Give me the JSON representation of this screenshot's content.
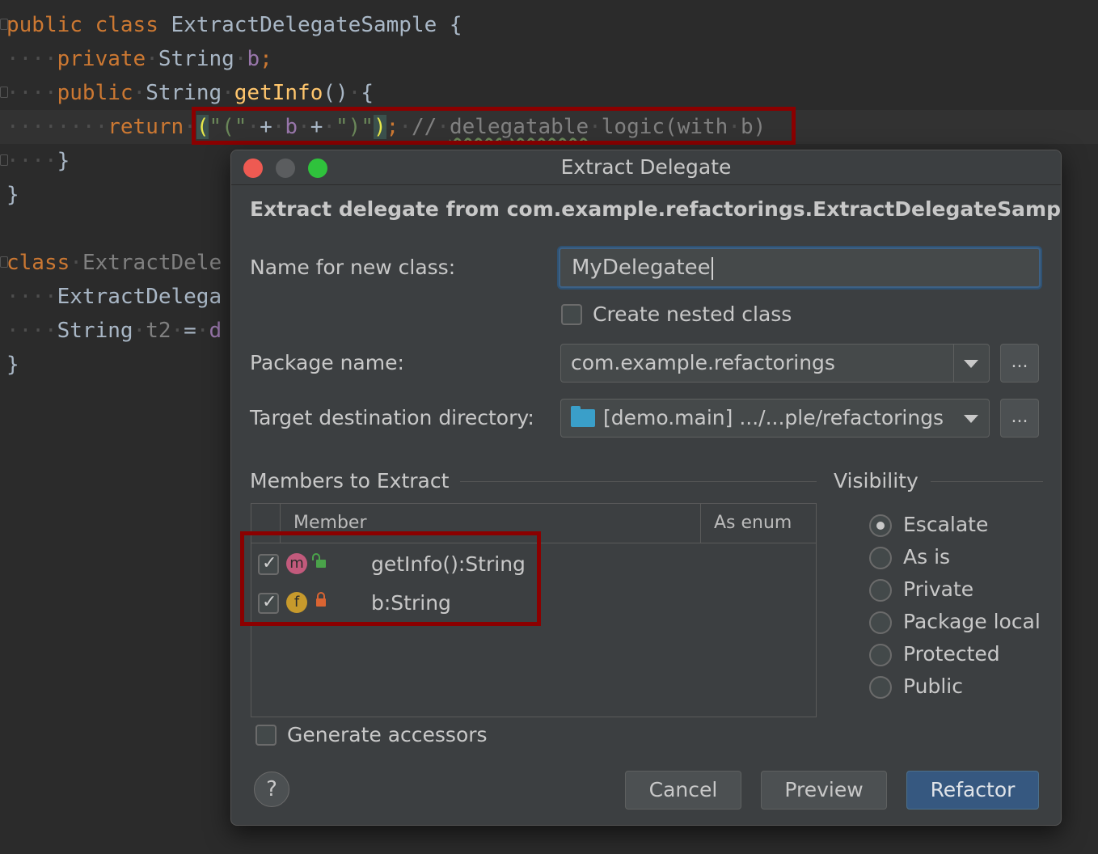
{
  "editor": {
    "lines": [
      {
        "segments": [
          {
            "t": "public",
            "c": "kw"
          },
          {
            "t": " ",
            "c": "dot"
          },
          {
            "t": "class",
            "c": "kw"
          },
          {
            "t": " ",
            "c": "dot"
          },
          {
            "t": "ExtractDelegateSample",
            "c": ""
          },
          {
            "t": " ",
            "c": "dot"
          },
          {
            "t": "{",
            "c": ""
          }
        ]
      },
      {
        "segments": [
          {
            "t": "····",
            "c": "dot"
          },
          {
            "t": "private",
            "c": "kw"
          },
          {
            "t": "·",
            "c": "dot"
          },
          {
            "t": "String",
            "c": ""
          },
          {
            "t": "·",
            "c": "dot"
          },
          {
            "t": "b",
            "c": "fld"
          },
          {
            "t": ";",
            "c": "kw"
          }
        ]
      },
      {
        "segments": [
          {
            "t": "····",
            "c": "dot"
          },
          {
            "t": "public",
            "c": "kw"
          },
          {
            "t": "·",
            "c": "dot"
          },
          {
            "t": "String",
            "c": ""
          },
          {
            "t": "·",
            "c": "dot"
          },
          {
            "t": "getInfo",
            "c": "fn"
          },
          {
            "t": "()",
            "c": ""
          },
          {
            "t": "·",
            "c": "dot"
          },
          {
            "t": "{",
            "c": ""
          }
        ]
      },
      {
        "segments": [
          {
            "t": "········",
            "c": "dot"
          },
          {
            "t": "return",
            "c": "kw"
          },
          {
            "t": "·",
            "c": "dot"
          },
          {
            "t": "(",
            "c": "br"
          },
          {
            "t": "\"(\"",
            "c": "str"
          },
          {
            "t": "·",
            "c": "dot"
          },
          {
            "t": "+",
            "c": ""
          },
          {
            "t": "·",
            "c": "dot"
          },
          {
            "t": "b",
            "c": "fld"
          },
          {
            "t": "·",
            "c": "dot"
          },
          {
            "t": "+",
            "c": ""
          },
          {
            "t": "·",
            "c": "dot"
          },
          {
            "t": "\")\"",
            "c": "str"
          },
          {
            "t": ")",
            "c": "br"
          },
          {
            "t": ";",
            "c": "kw"
          },
          {
            "t": "·",
            "c": "dot"
          },
          {
            "t": "//",
            "c": "cm"
          },
          {
            "t": "·",
            "c": "dot"
          },
          {
            "t": "delegatable",
            "c": "cm wavy"
          },
          {
            "t": "·",
            "c": "dot"
          },
          {
            "t": "logic(with",
            "c": "cm"
          },
          {
            "t": "·",
            "c": "dot"
          },
          {
            "t": "b)",
            "c": "cm"
          }
        ]
      },
      {
        "segments": [
          {
            "t": "····",
            "c": "dot"
          },
          {
            "t": "}",
            "c": ""
          }
        ]
      },
      {
        "segments": [
          {
            "t": "}",
            "c": ""
          }
        ]
      },
      {
        "segments": []
      },
      {
        "segments": [
          {
            "t": "class",
            "c": "kw"
          },
          {
            "t": "·",
            "c": "dot"
          },
          {
            "t": "ExtractDele",
            "c": "cm"
          }
        ]
      },
      {
        "segments": [
          {
            "t": "····",
            "c": "dot"
          },
          {
            "t": "ExtractDelega",
            "c": ""
          }
        ]
      },
      {
        "segments": [
          {
            "t": "····",
            "c": "dot"
          },
          {
            "t": "String",
            "c": ""
          },
          {
            "t": "·",
            "c": "dot"
          },
          {
            "t": "t2",
            "c": "cm"
          },
          {
            "t": "·",
            "c": "dot"
          },
          {
            "t": "=",
            "c": ""
          },
          {
            "t": "·",
            "c": "dot"
          },
          {
            "t": "d",
            "c": "fld"
          }
        ]
      },
      {
        "segments": [
          {
            "t": "}",
            "c": ""
          }
        ]
      }
    ]
  },
  "dialog": {
    "title": "Extract Delegate",
    "heading": "Extract delegate from com.example.refactorings.ExtractDelegateSample",
    "name_label": "Name for new class:",
    "name_value": "MyDelegatee",
    "nested_label": "Create nested class",
    "nested_checked": false,
    "package_label": "Package name:",
    "package_value": "com.example.refactorings",
    "package_browse": "...",
    "target_label": "Target destination directory:",
    "target_value": "[demo.main] .../...ple/refactorings",
    "target_browse": "...",
    "members_title": "Members to Extract",
    "columns": {
      "member": "Member",
      "as_enum": "As enum"
    },
    "members": [
      {
        "name": "getInfo():String",
        "kind": "m",
        "checked": true,
        "lock": "open"
      },
      {
        "name": "b:String",
        "kind": "f",
        "checked": true,
        "lock": "closed"
      }
    ],
    "visibility_title": "Visibility",
    "visibility_options": [
      "Escalate",
      "As is",
      "Private",
      "Package local",
      "Protected",
      "Public"
    ],
    "visibility_selected": "Escalate",
    "accessors_label": "Generate accessors",
    "help_label": "?",
    "buttons": {
      "cancel": "Cancel",
      "preview": "Preview",
      "refactor": "Refactor"
    }
  },
  "colors": {
    "keyword": "#cc7832",
    "function": "#ffc66d",
    "field": "#9876aa",
    "string": "#6a8759",
    "primary_button": "#365880",
    "annotation_red": "#8b0000"
  }
}
